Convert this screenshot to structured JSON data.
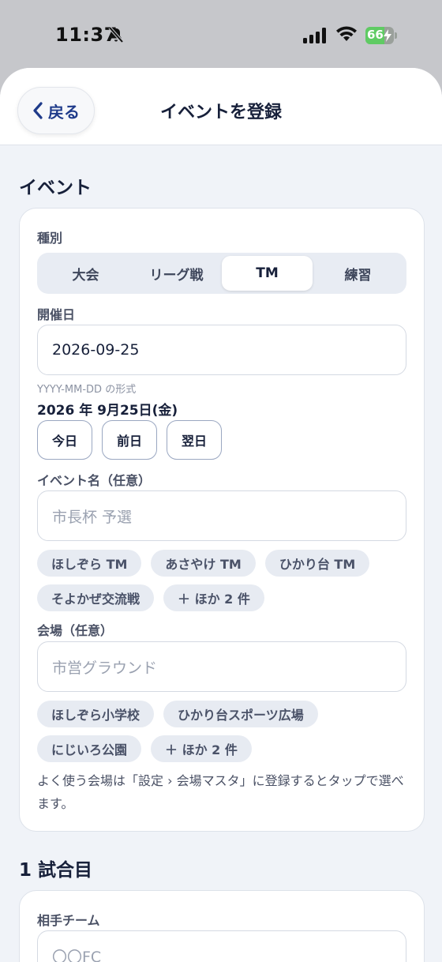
{
  "status": {
    "time": "11:37",
    "battery": "66",
    "battery_level": 0.66
  },
  "nav": {
    "back_label": "戻る",
    "title": "イベントを登録"
  },
  "event_section": {
    "title": "イベント",
    "type_label": "種別",
    "types": [
      "大会",
      "リーグ戦",
      "TM",
      "練習"
    ],
    "selected_type": "TM",
    "date_label": "開催日",
    "date_value": "2026-09-25",
    "date_hint": "YYYY-MM-DD の形式",
    "date_display": "2026 年 9月25日(金)",
    "quick_dates": [
      "今日",
      "前日",
      "翌日"
    ],
    "name_label": "イベント名（任意）",
    "name_placeholder": "市長杯 予選",
    "name_suggestions_row1": [
      "ほしぞら TM",
      "あさやけ TM",
      "ひかり台 TM"
    ],
    "name_suggestions_row2": [
      "そよかぜ交流戦",
      "＋ ほか 2 件"
    ],
    "venue_label": "会場（任意）",
    "venue_placeholder": "市営グラウンド",
    "venue_suggestions_row1": [
      "ほしぞら小学校",
      "ひかり台スポーツ広場"
    ],
    "venue_suggestions_row2": [
      "にじいろ公園",
      "＋ ほか 2 件"
    ],
    "venue_note": "よく使う会場は「設定 › 会場マスタ」に登録するとタップで選べます。"
  },
  "match_section": {
    "title": "1 試合目",
    "opponent_label": "相手チーム",
    "opponent_placeholder": "〇〇FC"
  }
}
